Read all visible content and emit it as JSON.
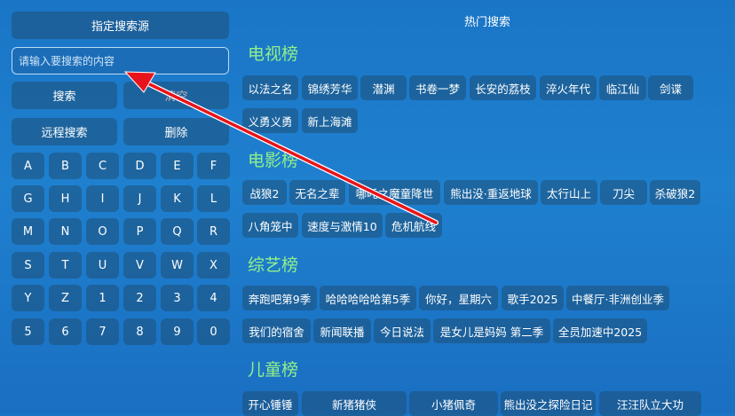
{
  "left": {
    "source_button": "指定搜索源",
    "search_input_placeholder": "请输入要搜索的内容",
    "search_button": "搜索",
    "clear_button": "清空",
    "remote_search_button": "远程搜索",
    "delete_button": "删除",
    "keys": [
      "A",
      "B",
      "C",
      "D",
      "E",
      "F",
      "G",
      "H",
      "I",
      "J",
      "K",
      "L",
      "M",
      "N",
      "O",
      "P",
      "Q",
      "R",
      "S",
      "T",
      "U",
      "V",
      "W",
      "X",
      "Y",
      "Z",
      "1",
      "2",
      "3",
      "4",
      "5",
      "6",
      "7",
      "8",
      "9",
      "0"
    ]
  },
  "right": {
    "title": "热门搜索",
    "sections": [
      {
        "title": "电视榜",
        "items": [
          "以法之名",
          "锦绣芳华",
          "潜渊",
          "书卷一梦",
          "长安的荔枝",
          "淬火年代",
          "临江仙",
          "剑谍",
          "义勇义勇",
          "新上海滩"
        ]
      },
      {
        "title": "电影榜",
        "items": [
          "战狼2",
          "无名之辈",
          "哪吒之魔童降世",
          "熊出没·重返地球",
          "太行山上",
          "刀尖",
          "杀破狼2",
          "八角笼中",
          "速度与激情10",
          "危机航线"
        ]
      },
      {
        "title": "综艺榜",
        "items": [
          "奔跑吧第9季",
          "哈哈哈哈哈第5季",
          "你好，星期六",
          "歌手2025",
          "中餐厅·非洲创业季",
          "我们的宿舍",
          "新闻联播",
          "今日说法",
          "是女儿是妈妈 第二季",
          "全员加速中2025"
        ]
      },
      {
        "title": "儿童榜",
        "items": [
          "开心锤锤",
          "新猪猪侠",
          "小猪佩奇",
          "熊出没之探险日记",
          "汪汪队立大功"
        ]
      }
    ]
  },
  "colors": {
    "accent_title": "#90f08a",
    "arrow": "#e8141b"
  }
}
